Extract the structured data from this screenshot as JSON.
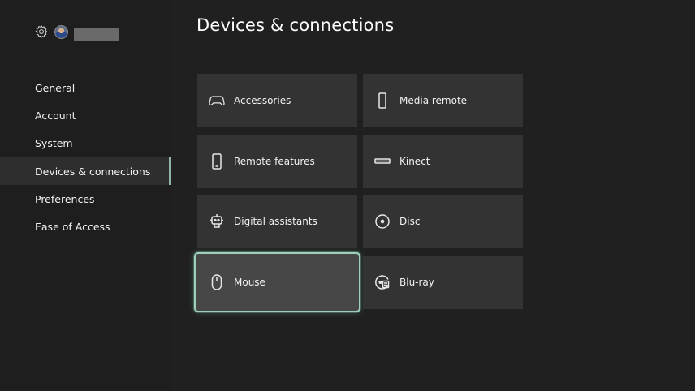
{
  "sidebar": {
    "nav": [
      {
        "label": "General"
      },
      {
        "label": "Account"
      },
      {
        "label": "System"
      },
      {
        "label": "Devices & connections",
        "selected": true
      },
      {
        "label": "Preferences"
      },
      {
        "label": "Ease of Access"
      }
    ]
  },
  "main": {
    "title": "Devices & connections",
    "tiles": [
      {
        "label": "Accessories",
        "icon": "controller-icon"
      },
      {
        "label": "Media remote",
        "icon": "media-remote-icon"
      },
      {
        "label": "Remote features",
        "icon": "phone-icon"
      },
      {
        "label": "Kinect",
        "icon": "kinect-icon"
      },
      {
        "label": "Digital assistants",
        "icon": "assistant-icon"
      },
      {
        "label": "Disc",
        "icon": "disc-icon"
      },
      {
        "label": "Mouse",
        "icon": "mouse-icon",
        "focused": true
      },
      {
        "label": "Blu-ray",
        "icon": "blu-ray-icon"
      }
    ]
  },
  "colors": {
    "background": "#202020",
    "tile": "#333333",
    "tile_focused": "#474747",
    "focus_accent": "#9fd0bb"
  }
}
